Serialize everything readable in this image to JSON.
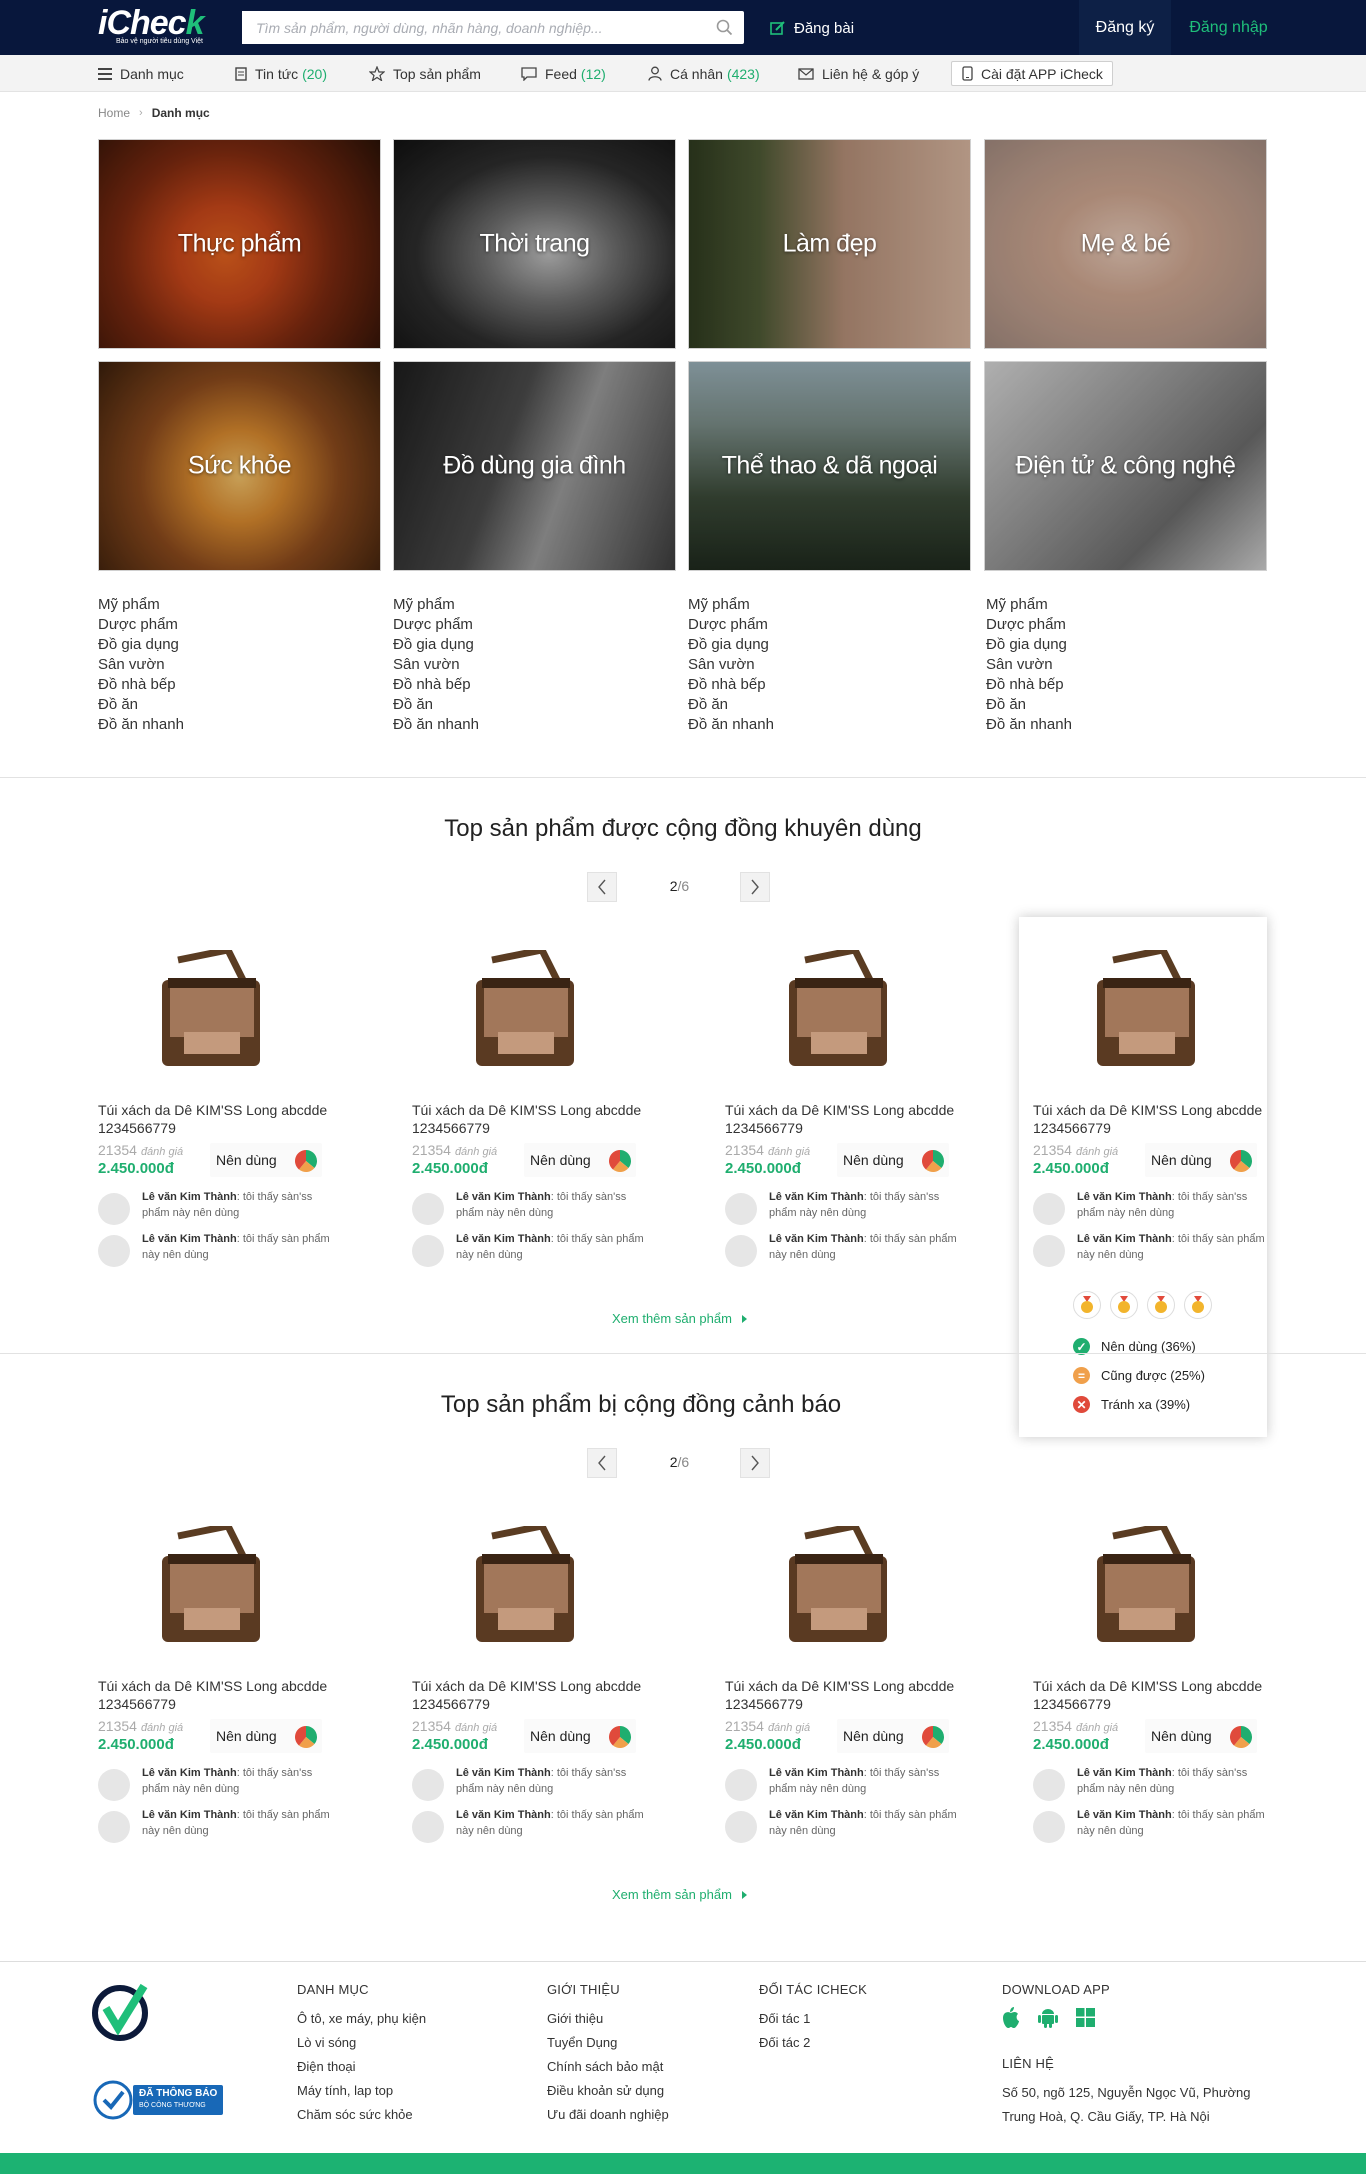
{
  "header": {
    "logo": "iCheck",
    "tagline": "Bảo vệ người tiêu dùng Việt",
    "search_placeholder": "Tìm sản phẩm, người dùng, nhãn hàng, doanh nghiệp...",
    "post_label": "Đăng bài",
    "register_label": "Đăng ký",
    "login_label": "Đăng nhập"
  },
  "nav": {
    "categories": "Danh mục",
    "news": "Tin tức",
    "news_count": "(20)",
    "top_products": "Top sản phẩm",
    "feed": "Feed",
    "feed_count": "(12)",
    "personal": "Cá nhân",
    "personal_count": "(423)",
    "contact": "Liên hệ & góp ý",
    "install_app": "Cài đặt APP iCheck"
  },
  "breadcrumb": {
    "home": "Home",
    "current": "Danh mục"
  },
  "tiles": [
    {
      "label": "Thực phẩm"
    },
    {
      "label": "Thời trang"
    },
    {
      "label": "Làm đẹp"
    },
    {
      "label": "Mẹ & bé"
    },
    {
      "label": "Sức khỏe"
    },
    {
      "label": "Đồ dùng gia đình"
    },
    {
      "label": "Thể thao & dã ngoại"
    },
    {
      "label": "Điện tử & công nghệ"
    }
  ],
  "subcategories": [
    [
      "Mỹ phẩm",
      "Dược phẩm",
      "Đồ gia dụng",
      "Sân vườn",
      "Đồ nhà bếp",
      "Đồ ăn",
      "Đồ ăn nhanh"
    ],
    [
      "Mỹ phẩm",
      "Dược phẩm",
      "Đồ gia dụng",
      "Sân vườn",
      "Đồ nhà bếp",
      "Đồ ăn",
      "Đồ ăn nhanh"
    ],
    [
      "Mỹ phẩm",
      "Dược phẩm",
      "Đồ gia dụng",
      "Sân vườn",
      "Đồ nhà bếp",
      "Đồ ăn",
      "Đồ ăn nhanh"
    ],
    [
      "Mỹ phẩm",
      "Dược phẩm",
      "Đồ gia dụng",
      "Sân vườn",
      "Đồ nhà bếp",
      "Đồ ăn",
      "Đồ ăn nhanh"
    ]
  ],
  "product": {
    "name": "Túi xách da Dê KIM'SS Long abcdde 1234566779",
    "rating_count": "21354",
    "rating_label": "đánh giá",
    "price": "2.450.000đ",
    "recommend": "Nên dùng",
    "review1_user": "Lê văn Kim Thành",
    "review1_text": ": tôi thấy sàn'ss phẩm này nên dùng",
    "review2_user": "Lê văn Kim Thành",
    "review2_text": ": tôi thấy sàn phẩm này nên dùng"
  },
  "section1": {
    "title": "Top sản phẩm được cộng đồng khuyên dùng",
    "page": "2",
    "total": "/6",
    "more": "Xem thêm sản phẩm"
  },
  "section2": {
    "title": "Top sản phẩm bị cộng đồng cảnh báo",
    "page": "2",
    "total": "/6",
    "more": "Xem thêm sản phẩm"
  },
  "popup": {
    "should_use": "Nên dùng (36%)",
    "usable": "Cũng được (25%)",
    "avoid": "Tránh xa (39%)"
  },
  "vote_shares": {
    "should_use": 36,
    "usable": 25,
    "avoid": 39
  },
  "footer": {
    "col1_title": "Danh mục",
    "col1": [
      "Ô tô, xe máy, phụ kiện",
      "Lò vi sóng",
      "Điện thoại",
      "Máy tính, lap top",
      "Chăm sóc sức khỏe"
    ],
    "col2_title": "Giới thiệu",
    "col2": [
      "Giới thiệu",
      "Tuyển Dụng",
      "Chính sách bảo mật",
      "Điều khoản sử dụng",
      "Ưu đãi doanh nghiệp"
    ],
    "col3_title": "Đối tác iCheck",
    "col3": [
      "Đối tác 1",
      "Đối tác 2"
    ],
    "download_title": "Download app",
    "contact_title": "Liên hệ",
    "address": "Số 50, ngõ 125, Nguyễn Ngọc Vũ, Phường Trung Hoà, Q. Cầu Giấy, TP. Hà Nội",
    "badge_main": "ĐÃ THÔNG BÁO",
    "badge_sub": "BỘ CÔNG THƯƠNG"
  },
  "colors": {
    "navy": "#08173c",
    "green": "#1fae6f",
    "orange": "#f0a04b",
    "red": "#e04a3b"
  }
}
